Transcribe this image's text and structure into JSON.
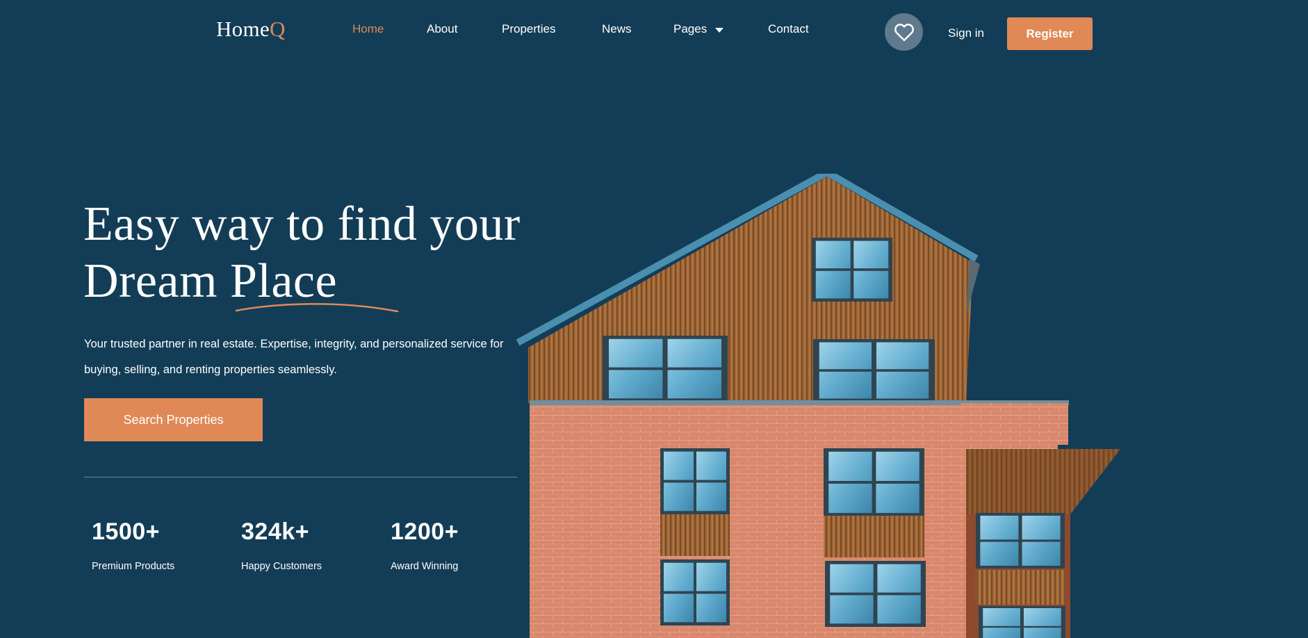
{
  "brand": {
    "logo_main": "Home",
    "logo_accent": "Q"
  },
  "nav": {
    "items": [
      {
        "label": "Home",
        "active": true
      },
      {
        "label": "About"
      },
      {
        "label": "Properties"
      },
      {
        "label": "News"
      },
      {
        "label": "Pages",
        "has_dropdown": true
      },
      {
        "label": "Contact"
      }
    ],
    "sign_in": "Sign in",
    "register": "Register",
    "wishlist_icon": "heart-icon"
  },
  "hero": {
    "title_line1": "Easy way to find your",
    "title_line2": "Dream Place",
    "description": "Your trusted partner in real estate. Expertise, integrity, and personalized service for buying, selling, and renting properties seamlessly.",
    "cta": "Search Properties",
    "image": "brick-and-timber-apartment-building"
  },
  "stats": [
    {
      "value": "1500+",
      "label": "Premium Products"
    },
    {
      "value": "324k+",
      "label": "Happy Customers"
    },
    {
      "value": "1200+",
      "label": "Award Winning"
    }
  ],
  "colors": {
    "background": "#133d56",
    "accent": "#e08957",
    "text": "#ffffff",
    "icon_circle": "#5e7a8c"
  }
}
